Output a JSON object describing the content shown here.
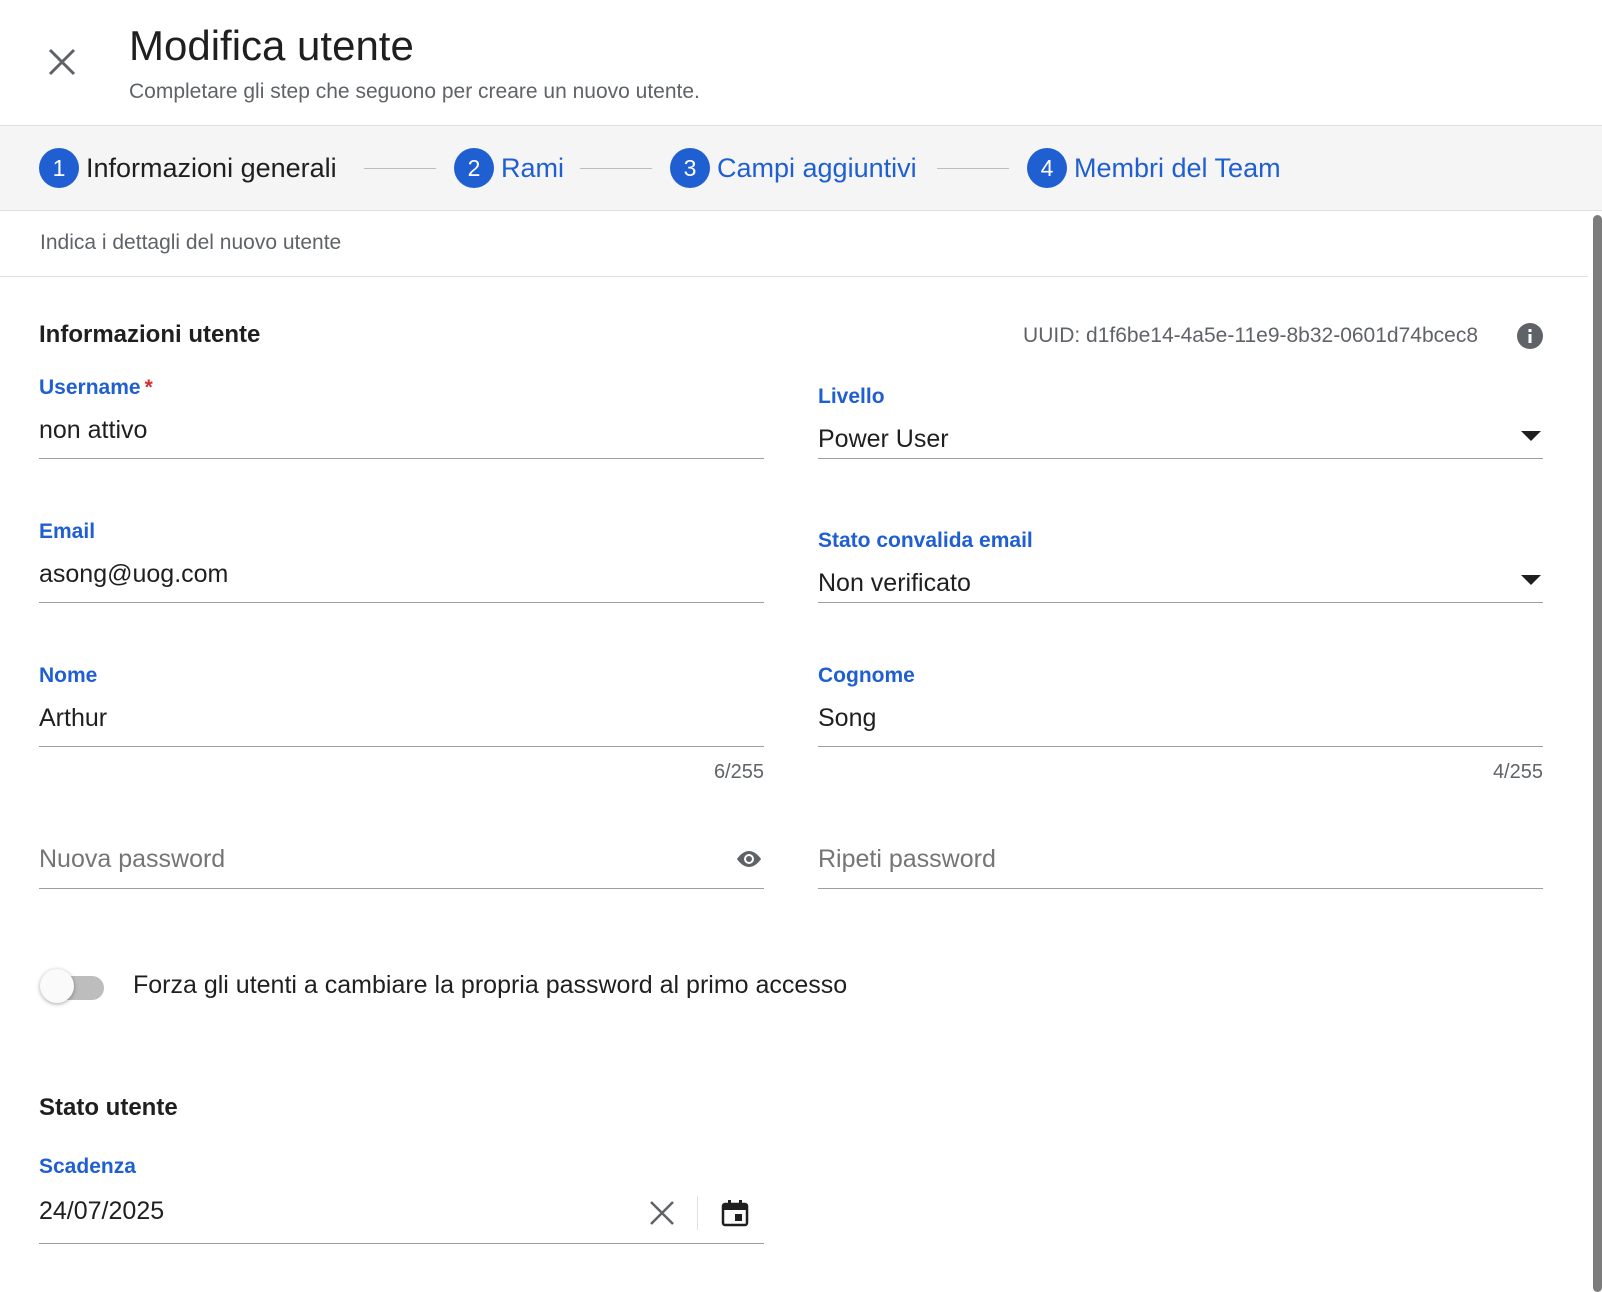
{
  "header": {
    "title": "Modifica utente",
    "subtitle": "Completare gli step che seguono per creare un nuovo utente."
  },
  "stepper": {
    "steps": [
      {
        "number": "1",
        "label": "Informazioni generali",
        "active": true
      },
      {
        "number": "2",
        "label": "Rami",
        "active": false
      },
      {
        "number": "3",
        "label": "Campi aggiuntivi",
        "active": false
      },
      {
        "number": "4",
        "label": "Membri del Team",
        "active": false
      }
    ]
  },
  "hint": "Indica i dettagli del nuovo utente",
  "user_info": {
    "title": "Informazioni utente",
    "uuid": "UUID: d1f6be14-4a5e-11e9-8b32-0601d74bcec8",
    "username": {
      "label": "Username",
      "required": "*",
      "value": "non attivo"
    },
    "livello": {
      "label": "Livello",
      "value": "Power User"
    },
    "email": {
      "label": "Email",
      "value": "asong@uog.com"
    },
    "email_status": {
      "label": "Stato convalida email",
      "value": "Non verificato"
    },
    "nome": {
      "label": "Nome",
      "value": "Arthur",
      "counter": "6/255"
    },
    "cognome": {
      "label": "Cognome",
      "value": "Song",
      "counter": "4/255"
    },
    "new_password": {
      "placeholder": "Nuova password"
    },
    "repeat_password": {
      "placeholder": "Ripeti password"
    },
    "force_change": {
      "label": "Forza gli utenti a cambiare la propria password al primo accesso",
      "enabled": false
    }
  },
  "user_status": {
    "title": "Stato utente",
    "expiry": {
      "label": "Scadenza",
      "value": "24/07/2025"
    }
  },
  "colors": {
    "accent": "#1f5fd1",
    "required": "#d32f2f",
    "stepper_bg": "#f5f5f5"
  }
}
